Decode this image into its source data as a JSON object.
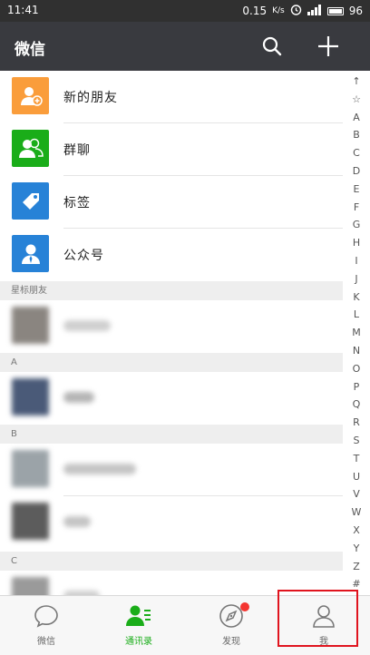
{
  "status_bar": {
    "time": "11:41",
    "network_speed": "0.15",
    "speed_unit": "K/s",
    "battery": "96"
  },
  "header": {
    "title": "微信"
  },
  "function_items": [
    {
      "label": "新的朋友",
      "icon": "new-friend-icon",
      "color": "#fa9d3b"
    },
    {
      "label": "群聊",
      "icon": "group-chat-icon",
      "color": "#1aad19"
    },
    {
      "label": "标签",
      "icon": "tag-icon",
      "color": "#2782d7"
    },
    {
      "label": "公众号",
      "icon": "official-account-icon",
      "color": "#2782d7"
    }
  ],
  "sections": {
    "starred": "星标朋友",
    "a": "A",
    "b": "B",
    "c": "C"
  },
  "index_letters": [
    "↑",
    "☆",
    "A",
    "B",
    "C",
    "D",
    "E",
    "F",
    "G",
    "H",
    "I",
    "J",
    "K",
    "L",
    "M",
    "N",
    "O",
    "P",
    "Q",
    "R",
    "S",
    "T",
    "U",
    "V",
    "W",
    "X",
    "Y",
    "Z",
    "#"
  ],
  "tabs": [
    {
      "label": "微信",
      "icon": "chat-bubble-icon",
      "active": false
    },
    {
      "label": "通讯录",
      "icon": "contacts-icon",
      "active": true
    },
    {
      "label": "发现",
      "icon": "compass-icon",
      "active": false
    },
    {
      "label": "我",
      "icon": "profile-icon",
      "active": false
    }
  ],
  "colors": {
    "accent": "#1aad19",
    "titlebar": "#393a3f",
    "badge": "#f43530",
    "highlight": "#e0141e"
  }
}
